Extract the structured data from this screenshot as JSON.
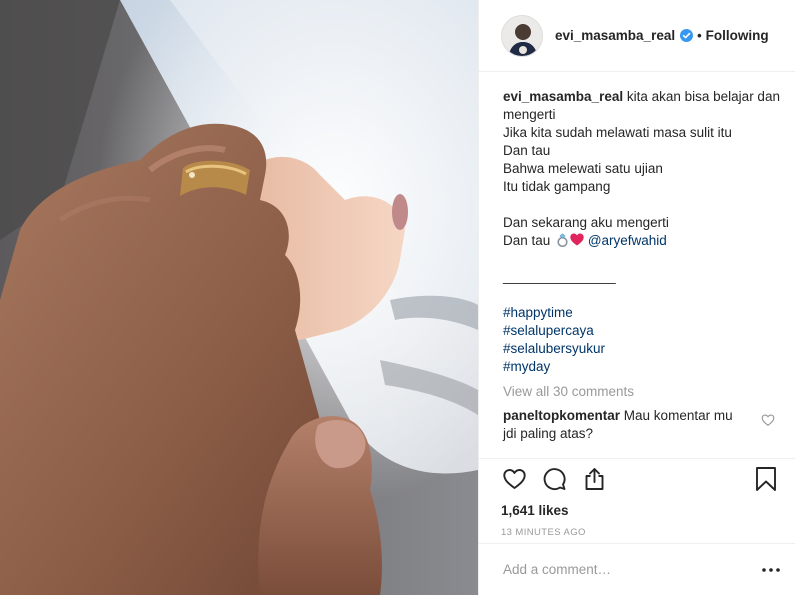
{
  "header": {
    "username": "evi_masamba_real",
    "separator": "•",
    "follow_label": "Following"
  },
  "caption": {
    "username": "evi_masamba_real",
    "first_line": "kita akan bisa belajar dan",
    "lines": [
      "mengerti",
      "Jika kita sudah melawati masa sulit itu",
      "Dan tau",
      "Bahwa melewati satu ujian",
      "Itu tidak gampang"
    ],
    "line_after_blank": "Dan sekarang aku mengerti",
    "last_line_prefix": "Dan tau",
    "mention": "@aryefwahid",
    "rule": "_______________",
    "hashtags": [
      "#happytime",
      "#selalupercaya",
      "#selalubersyukur",
      "#myday"
    ]
  },
  "view_all_comments": "View all 30 comments",
  "comment": {
    "username": "paneltopkomentar",
    "text": "Mau komentar mu jdi paling atas?"
  },
  "likes": "1,641 likes",
  "timestamp": "13 MINUTES AGO",
  "add_comment_placeholder": "Add a comment…",
  "icons": {
    "like": "heart-icon",
    "comment": "comment-icon",
    "share": "share-icon",
    "save": "bookmark-icon",
    "more": "more-options-icon",
    "verified": "verified-badge-icon"
  },
  "colors": {
    "text": "#262626",
    "muted": "#999999",
    "link": "#003569",
    "verified": "#3897f0",
    "heart_emoji": "#e0245e"
  }
}
